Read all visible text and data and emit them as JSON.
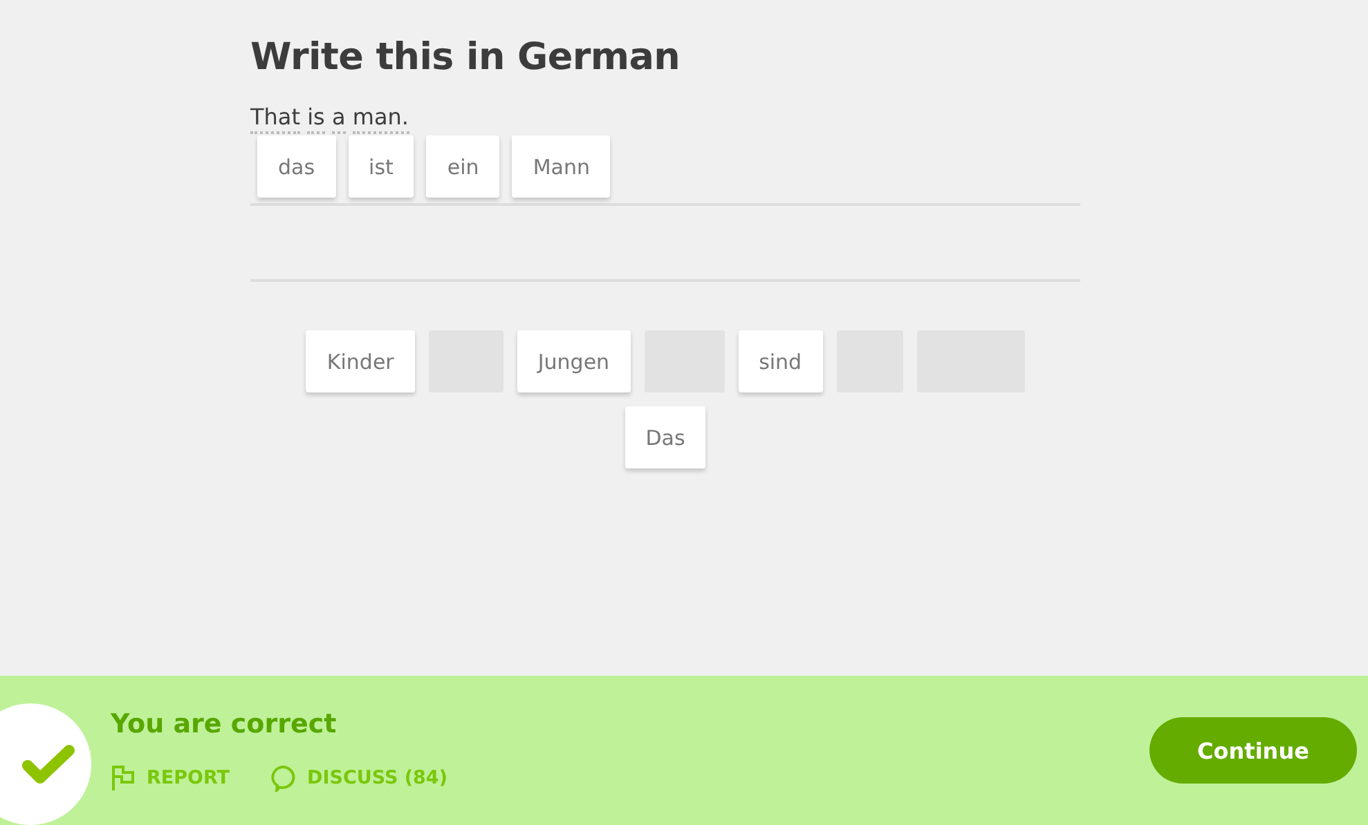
{
  "title": "Write this in German",
  "prompt": "That is a man.",
  "answer_tiles": [
    "das",
    "ist",
    "ein",
    "Mann"
  ],
  "word_bank": [
    {
      "label": "Kinder",
      "used": false
    },
    {
      "used": true
    },
    {
      "label": "Jungen",
      "used": false
    },
    {
      "used": true
    },
    {
      "label": "sind",
      "used": false
    },
    {
      "used": true
    },
    {
      "used": true
    },
    {
      "label": "Das",
      "used": false
    }
  ],
  "feedback": {
    "message": "You are correct",
    "correct": true,
    "report": "REPORT",
    "discuss": "DISCUSS (84)",
    "continue": "Continue"
  }
}
